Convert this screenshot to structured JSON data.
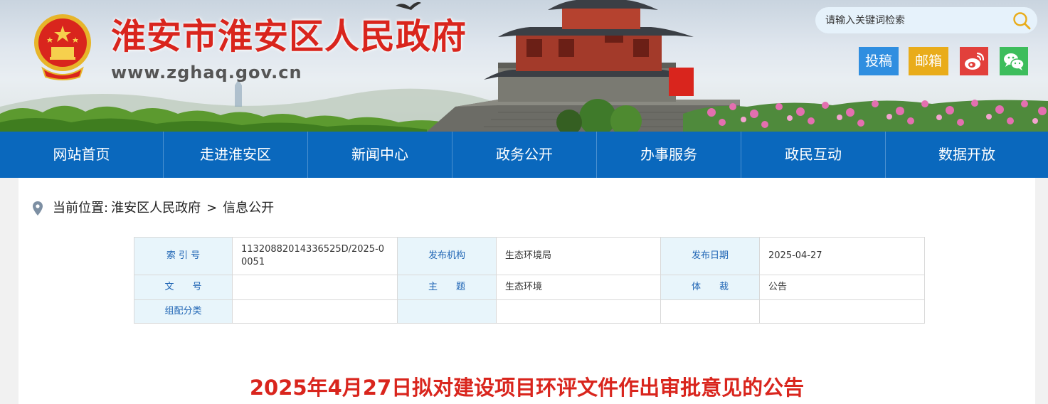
{
  "header": {
    "site_title": "淮安市淮安区人民政府",
    "site_url": "www.zghaq.gov.cn",
    "search_placeholder": "请输入关键词检索",
    "buttons": {
      "tougao": "投稿",
      "youxiang": "邮箱"
    },
    "icons": [
      "national-emblem",
      "search-icon",
      "weibo-icon",
      "wechat-icon"
    ]
  },
  "nav": {
    "items": [
      "网站首页",
      "走进淮安区",
      "新闻中心",
      "政务公开",
      "办事服务",
      "政民互动",
      "数据开放"
    ]
  },
  "breadcrumb": {
    "label": "当前位置:",
    "items": [
      "淮安区人民政府",
      "信息公开"
    ],
    "separator": ">"
  },
  "info_table": {
    "index_label": "索 引 号",
    "index_value": "11320882014336525D/2025-00051",
    "publisher_label": "发布机构",
    "publisher_value": "生态环境局",
    "date_label": "发布日期",
    "date_value": "2025-04-27",
    "doc_no_label": "文　　号",
    "doc_no_value": "",
    "topic_label": "主　　题",
    "topic_value": "生态环境",
    "genre_label": "体　　裁",
    "genre_value": "公告",
    "category_label": "组配分类",
    "category_value": ""
  },
  "article": {
    "title": "2025年4月27日拟对建设项目环评文件作出审批意见的公告"
  },
  "colors": {
    "brand_red": "#d9251d",
    "nav_blue": "#0a68bd",
    "table_header_bg": "#e8f5fb",
    "table_header_text": "#1e64b4",
    "tougao_bg": "#2f8ee0",
    "youxiang_bg": "#e9ac1a",
    "weibo_bg": "#e2403b",
    "wechat_bg": "#3dbd5c"
  }
}
